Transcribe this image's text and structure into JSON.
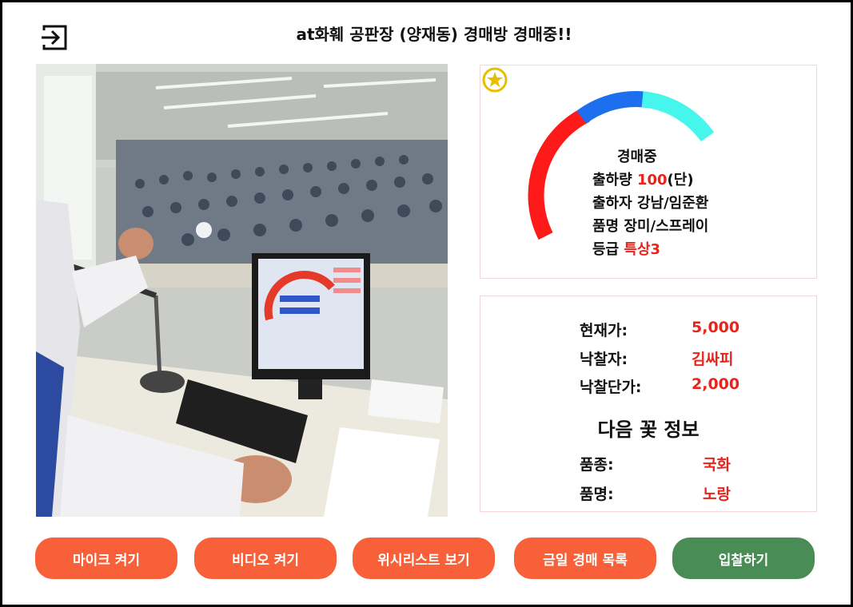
{
  "header": {
    "title": "at화훼 공판장 (양재동) 경매방 경매중!!",
    "exit_icon": "exit-icon"
  },
  "auction_card": {
    "star_icon": "star-icon",
    "status": "경매중",
    "quantity_label": "출하량",
    "quantity_value": "100",
    "quantity_unit": "(단)",
    "shipper_label": "출하자",
    "shipper_value": "강남/임준환",
    "item_label": "품명",
    "item_value": "장미/스프레이",
    "grade_label": "등급",
    "grade_value": "특상3",
    "gauge_colors": [
      "#ff1a1a",
      "#1e6ff0",
      "#46f5ec"
    ]
  },
  "price_info": {
    "current_price_label": "현재가:",
    "current_price_value": "5,000",
    "winner_label": "낙찰자:",
    "winner_value": "김싸피",
    "winning_price_label": "낙찰단가:",
    "winning_price_value": "2,000"
  },
  "next_flower": {
    "title": "다음 꽃 정보",
    "variety_label": "품종:",
    "variety_value": "국화",
    "name_label": "품명:",
    "name_value": "노랑"
  },
  "buttons": [
    {
      "label": "마이크 켜기",
      "color": "#f8603a"
    },
    {
      "label": "비디오 켜기",
      "color": "#f8603a"
    },
    {
      "label": "위시리스트 보기",
      "color": "#f8603a"
    },
    {
      "label": "금일 경매 목록",
      "color": "#f8603a"
    },
    {
      "label": "입찰하기",
      "color": "#4a8c55"
    }
  ]
}
